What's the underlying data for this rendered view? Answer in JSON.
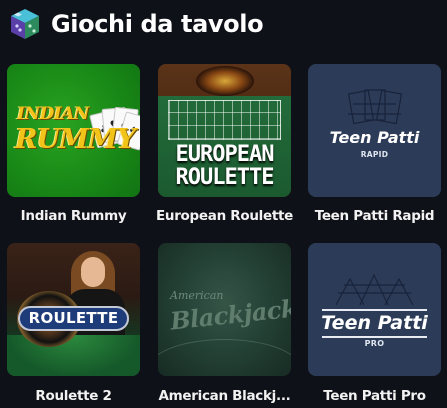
{
  "header": {
    "title": "Giochi da tavolo",
    "icon": "cube-icon"
  },
  "games": [
    {
      "label": "Indian Rummy",
      "art_line1": "INDIAN",
      "art_line2": "RUMMY"
    },
    {
      "label": "European Roulette",
      "art_line1": "EUROPEAN",
      "art_line2": "ROULETTE"
    },
    {
      "label": "Teen Patti Rapid",
      "art_name": "Teen Patti",
      "art_sub": "RAPID"
    },
    {
      "label": "Roulette 2",
      "art_badge": "ROULETTE"
    },
    {
      "label": "American Blackj...",
      "art_line1": "American",
      "art_line2": "Blackjack"
    },
    {
      "label": "Teen Patti Pro",
      "art_name": "Teen Patti",
      "art_sub": "PRO"
    }
  ],
  "colors": {
    "background": "#0f1118",
    "teen_patti_tile": "#2c3c58",
    "rummy_gold": "#f2c419",
    "roulette_badge": "#1e3c79"
  }
}
